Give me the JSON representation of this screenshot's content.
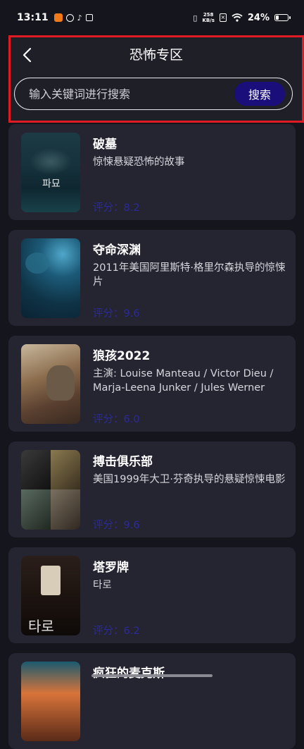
{
  "status_bar": {
    "time": "13:11",
    "speed_top": "258",
    "speed_bottom": "KB/s",
    "battery": "24%",
    "battery_level": 0.24
  },
  "header": {
    "title": "恐怖专区"
  },
  "search": {
    "placeholder": "输入关键词进行搜索",
    "button_label": "搜索"
  },
  "movies": [
    {
      "title": "破墓",
      "desc": "惊悚悬疑恐怖的故事",
      "rating": "评分：8.2"
    },
    {
      "title": "夺命深渊",
      "desc": "2011年美国阿里斯特·格里尔森执导的惊悚片",
      "rating": "评分：9.6"
    },
    {
      "title": "狼孩2022",
      "desc": "主演: Louise Manteau / Victor Dieu / Marja-Leena Junker / Jules Werner",
      "rating": "评分：6.0"
    },
    {
      "title": "搏击俱乐部",
      "desc": "美国1999年大卫·芬奇执导的悬疑惊悚电影",
      "rating": "评分：9.6"
    },
    {
      "title": "塔罗牌",
      "desc": "타로",
      "rating": "评分：6.2"
    },
    {
      "title": "疯狂的麦克斯",
      "desc": "",
      "rating": ""
    }
  ]
}
